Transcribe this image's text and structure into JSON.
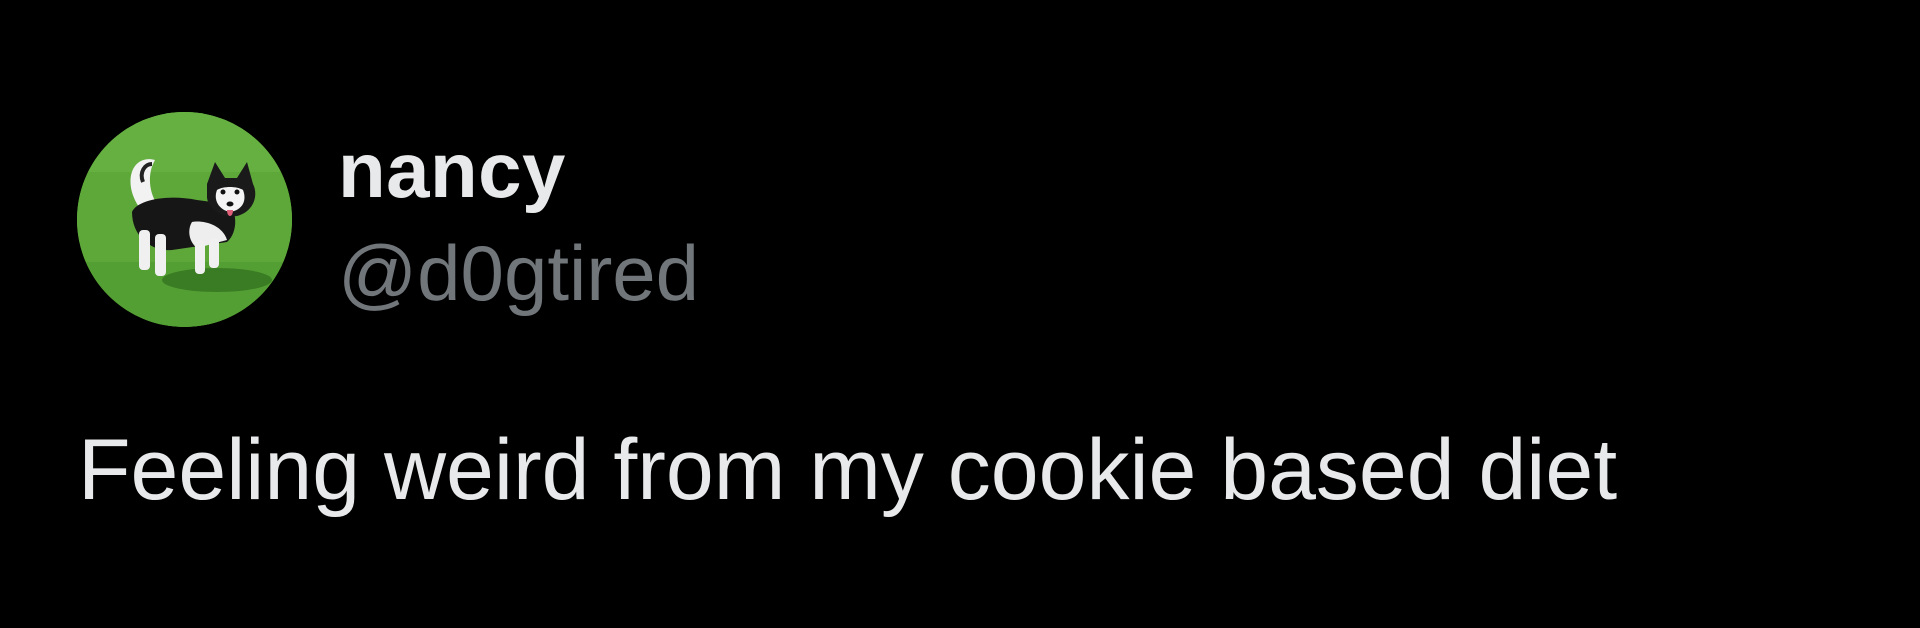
{
  "tweet": {
    "author": {
      "display_name": "nancy",
      "handle": "@d0gtired",
      "avatar_icon": "husky-dog-on-grass-avatar"
    },
    "text": "Feeling weird from my cookie based diet"
  },
  "colors": {
    "background": "#000000",
    "primary_text": "#e7e9ea",
    "secondary_text": "#71767b",
    "avatar_grass": "#5ea83a"
  }
}
